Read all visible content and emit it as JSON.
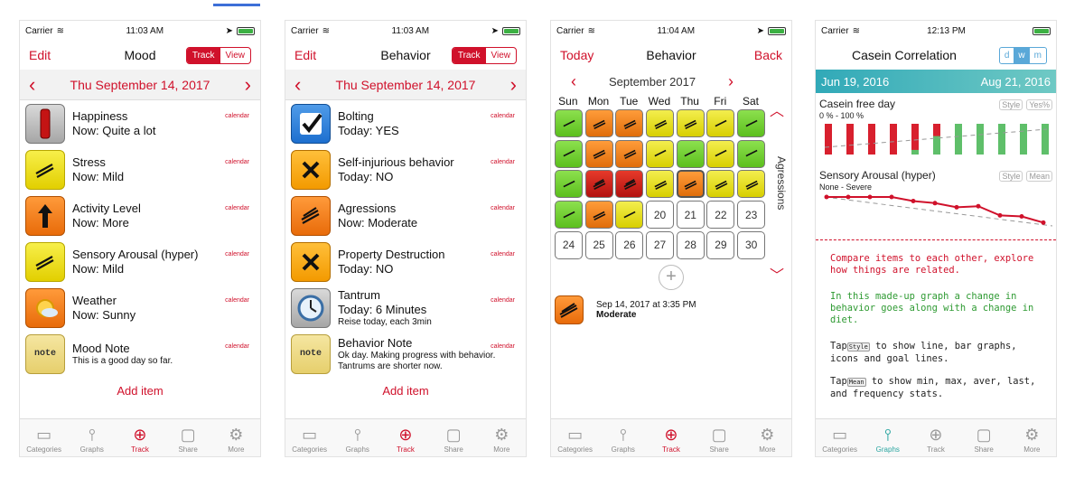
{
  "colors": {
    "accent": "#d0112b",
    "teal": "#31a9b8",
    "green": "#5cbf1d",
    "yellow": "#d8cf00",
    "orange": "#e06d0a",
    "red": "#b31210"
  },
  "screen1": {
    "status": {
      "carrier": "Carrier",
      "time": "11:03 AM"
    },
    "nav": {
      "left": "Edit",
      "title": "Mood",
      "seg": [
        "Track",
        "View"
      ]
    },
    "date": "Thu September 14, 2017",
    "items": [
      {
        "title": "Happiness",
        "sub": "Now: Quite a lot",
        "cal": "calendar",
        "icon": "thermometer-icon"
      },
      {
        "title": "Stress",
        "sub": "Now: Mild",
        "cal": "calendar",
        "icon": "mild-stroke-icon"
      },
      {
        "title": "Activity Level",
        "sub": "Now: More",
        "cal": "calendar",
        "icon": "up-arrow-icon"
      },
      {
        "title": "Sensory Arousal (hyper)",
        "sub": "Now: Mild",
        "cal": "calendar",
        "icon": "mild-stroke-icon"
      },
      {
        "title": "Weather",
        "sub": "Now: Sunny",
        "cal": "calendar",
        "icon": "sun-icon"
      },
      {
        "title": "Mood Note",
        "sub": "This is a good day so far.",
        "cal": "calendar",
        "icon": "note-icon",
        "iconText": "note"
      }
    ],
    "add": "Add item"
  },
  "screen2": {
    "status": {
      "carrier": "Carrier",
      "time": "11:03 AM"
    },
    "nav": {
      "left": "Edit",
      "title": "Behavior",
      "seg": [
        "Track",
        "View"
      ]
    },
    "date": "Thu September 14, 2017",
    "items": [
      {
        "title": "Bolting",
        "sub": "Today: YES",
        "cal": "calendar",
        "icon": "checkmark-icon"
      },
      {
        "title": "Self-injurious behavior",
        "sub": "Today: NO",
        "cal": "calendar",
        "icon": "x-mark-icon"
      },
      {
        "title": "Agressions",
        "sub": "Now: Moderate",
        "cal": "calendar",
        "icon": "moderate-stroke-icon"
      },
      {
        "title": "Property Destruction",
        "sub": "Today: NO",
        "cal": "calendar",
        "icon": "x-mark-icon"
      },
      {
        "title": "Tantrum",
        "sub": "Today: 6 Minutes",
        "sub2": "Reise today, each 3min",
        "cal": "calendar",
        "icon": "clock-icon"
      },
      {
        "title": "Behavior Note",
        "sub": "Ok day. Making progress with behavior. Tantrums are shorter now.",
        "cal": "calendar",
        "icon": "note-icon",
        "iconText": "note"
      }
    ],
    "add": "Add item"
  },
  "screen3": {
    "status": {
      "carrier": "Carrier",
      "time": "11:04 AM"
    },
    "nav": {
      "left": "Today",
      "title": "Behavior",
      "right": "Back"
    },
    "month": "September 2017",
    "weekdays": [
      "Sun",
      "Mon",
      "Tue",
      "Wed",
      "Thu",
      "Fri",
      "Sat"
    ],
    "days": [
      {
        "c": "g",
        "s": 1
      },
      {
        "c": "o",
        "s": 2
      },
      {
        "c": "o",
        "s": 2
      },
      {
        "c": "y",
        "s": 2
      },
      {
        "c": "y",
        "s": 2
      },
      {
        "c": "y",
        "s": 1
      },
      {
        "c": "g",
        "s": 1
      },
      {
        "c": "g",
        "s": 1
      },
      {
        "c": "o",
        "s": 2
      },
      {
        "c": "o",
        "s": 2
      },
      {
        "c": "y",
        "s": 1
      },
      {
        "c": "g",
        "s": 1
      },
      {
        "c": "y",
        "s": 1
      },
      {
        "c": "g",
        "s": 1
      },
      {
        "c": "g",
        "s": 1
      },
      {
        "c": "r",
        "s": 3
      },
      {
        "c": "r",
        "s": 3
      },
      {
        "c": "y",
        "s": 2
      },
      {
        "c": "o",
        "s": 2,
        "sel": true
      },
      {
        "c": "y",
        "s": 2
      },
      {
        "c": "y",
        "s": 2
      },
      {
        "c": "g",
        "s": 1
      },
      {
        "c": "o",
        "s": 2
      },
      {
        "c": "y",
        "s": 1
      },
      {
        "n": "20"
      },
      {
        "n": "21"
      },
      {
        "n": "22"
      },
      {
        "n": "23"
      },
      {
        "n": "24"
      },
      {
        "n": "25"
      },
      {
        "n": "26"
      },
      {
        "n": "27"
      },
      {
        "n": "28"
      },
      {
        "n": "29"
      },
      {
        "n": "30"
      }
    ],
    "side": "Agressions",
    "entry": {
      "when": "Sep 14, 2017 at 3:35 PM",
      "value": "Moderate"
    }
  },
  "screen4": {
    "status": {
      "carrier": "Carrier",
      "time": "12:13 PM"
    },
    "nav": {
      "title": "Casein Correlation",
      "seg": [
        "d",
        "w",
        "m"
      ]
    },
    "range": {
      "from": "Jun 19, 2016",
      "to": "Aug 21, 2016"
    },
    "chart1": {
      "name": "Casein free day",
      "range": "0 % - 100 %",
      "btn1": "Style",
      "btn2": "Yes%",
      "values": [
        0,
        0,
        0,
        0,
        15,
        60,
        100,
        100,
        100,
        100,
        100
      ]
    },
    "chart2": {
      "name": "Sensory Arousal (hyper)",
      "range": "None - Severe",
      "btn1": "Style",
      "btn2": "Mean",
      "values": [
        3,
        3,
        3,
        3,
        2.6,
        2.4,
        2,
        2.1,
        1.2,
        1.1,
        0.5
      ]
    },
    "notes": {
      "red": "Compare items to each other, explore how things are related.",
      "green": "In this made-up graph a change in behavior goes along with a change in diet.",
      "tap1a": "Tap",
      "tap1pill": "Style",
      "tap1b": "to show line, bar graphs, icons and goal lines.",
      "tap2a": "Tap",
      "tap2pill": "Mean",
      "tap2b": "to show min, max, aver, last, and frequency stats."
    }
  },
  "tabs": [
    "Categories",
    "Graphs",
    "Track",
    "Share",
    "More"
  ]
}
